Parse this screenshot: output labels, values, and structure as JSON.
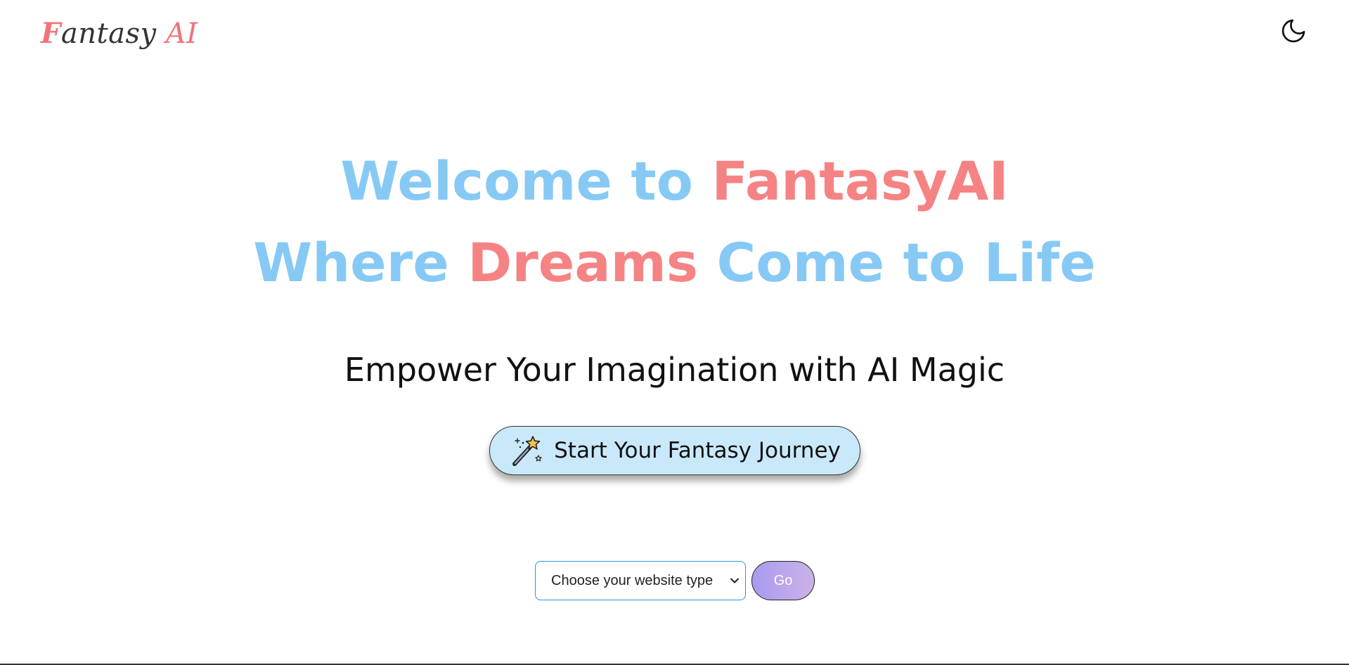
{
  "header": {
    "logo": {
      "first_letter": "F",
      "rest": "antasy",
      "suffix": "AI"
    },
    "theme_toggle_icon": "moon-icon"
  },
  "hero": {
    "line1": {
      "part1": "Welcome to ",
      "highlight": "FantasyAI"
    },
    "line2": {
      "part1": "Where ",
      "highlight": "Dreams",
      "part2": " Come to Life"
    },
    "tagline": "Empower Your Imagination with AI Magic",
    "cta": {
      "icon": "magic-wand-icon",
      "label": "Start Your Fantasy Journey"
    }
  },
  "controls": {
    "select": {
      "value": "Choose your website type",
      "icon": "chevron-down-icon"
    },
    "go_label": "Go"
  },
  "colors": {
    "accent_blue": "#87c9f5",
    "accent_pink": "#f68384",
    "cta_background": "#c9e9fb",
    "select_border": "#2a9ad6",
    "go_gradient_start": "#a99af0",
    "go_gradient_end": "#cbb2e6"
  }
}
